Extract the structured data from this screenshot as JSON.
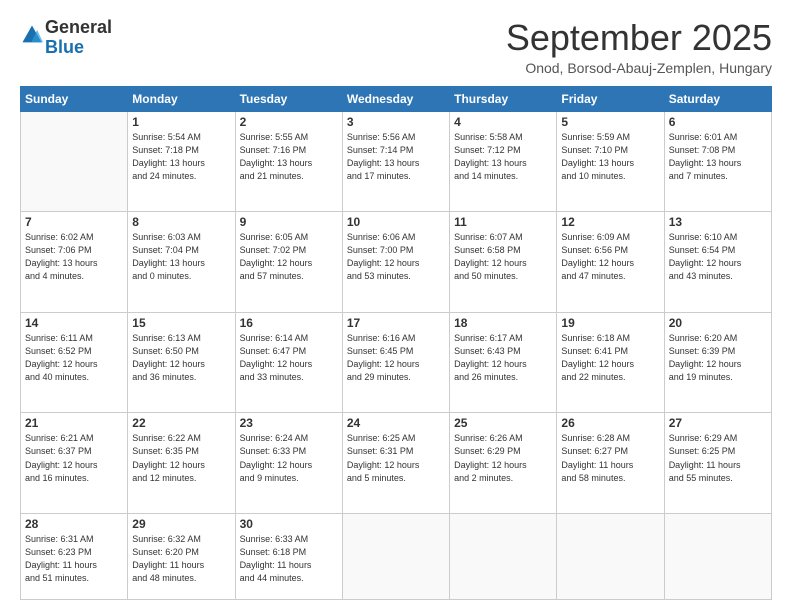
{
  "header": {
    "logo": {
      "line1": "General",
      "line2": "Blue"
    },
    "title": "September 2025",
    "location": "Onod, Borsod-Abauj-Zemplen, Hungary"
  },
  "days_of_week": [
    "Sunday",
    "Monday",
    "Tuesday",
    "Wednesday",
    "Thursday",
    "Friday",
    "Saturday"
  ],
  "weeks": [
    [
      {
        "day": "",
        "info": ""
      },
      {
        "day": "1",
        "info": "Sunrise: 5:54 AM\nSunset: 7:18 PM\nDaylight: 13 hours\nand 24 minutes."
      },
      {
        "day": "2",
        "info": "Sunrise: 5:55 AM\nSunset: 7:16 PM\nDaylight: 13 hours\nand 21 minutes."
      },
      {
        "day": "3",
        "info": "Sunrise: 5:56 AM\nSunset: 7:14 PM\nDaylight: 13 hours\nand 17 minutes."
      },
      {
        "day": "4",
        "info": "Sunrise: 5:58 AM\nSunset: 7:12 PM\nDaylight: 13 hours\nand 14 minutes."
      },
      {
        "day": "5",
        "info": "Sunrise: 5:59 AM\nSunset: 7:10 PM\nDaylight: 13 hours\nand 10 minutes."
      },
      {
        "day": "6",
        "info": "Sunrise: 6:01 AM\nSunset: 7:08 PM\nDaylight: 13 hours\nand 7 minutes."
      }
    ],
    [
      {
        "day": "7",
        "info": "Sunrise: 6:02 AM\nSunset: 7:06 PM\nDaylight: 13 hours\nand 4 minutes."
      },
      {
        "day": "8",
        "info": "Sunrise: 6:03 AM\nSunset: 7:04 PM\nDaylight: 13 hours\nand 0 minutes."
      },
      {
        "day": "9",
        "info": "Sunrise: 6:05 AM\nSunset: 7:02 PM\nDaylight: 12 hours\nand 57 minutes."
      },
      {
        "day": "10",
        "info": "Sunrise: 6:06 AM\nSunset: 7:00 PM\nDaylight: 12 hours\nand 53 minutes."
      },
      {
        "day": "11",
        "info": "Sunrise: 6:07 AM\nSunset: 6:58 PM\nDaylight: 12 hours\nand 50 minutes."
      },
      {
        "day": "12",
        "info": "Sunrise: 6:09 AM\nSunset: 6:56 PM\nDaylight: 12 hours\nand 47 minutes."
      },
      {
        "day": "13",
        "info": "Sunrise: 6:10 AM\nSunset: 6:54 PM\nDaylight: 12 hours\nand 43 minutes."
      }
    ],
    [
      {
        "day": "14",
        "info": "Sunrise: 6:11 AM\nSunset: 6:52 PM\nDaylight: 12 hours\nand 40 minutes."
      },
      {
        "day": "15",
        "info": "Sunrise: 6:13 AM\nSunset: 6:50 PM\nDaylight: 12 hours\nand 36 minutes."
      },
      {
        "day": "16",
        "info": "Sunrise: 6:14 AM\nSunset: 6:47 PM\nDaylight: 12 hours\nand 33 minutes."
      },
      {
        "day": "17",
        "info": "Sunrise: 6:16 AM\nSunset: 6:45 PM\nDaylight: 12 hours\nand 29 minutes."
      },
      {
        "day": "18",
        "info": "Sunrise: 6:17 AM\nSunset: 6:43 PM\nDaylight: 12 hours\nand 26 minutes."
      },
      {
        "day": "19",
        "info": "Sunrise: 6:18 AM\nSunset: 6:41 PM\nDaylight: 12 hours\nand 22 minutes."
      },
      {
        "day": "20",
        "info": "Sunrise: 6:20 AM\nSunset: 6:39 PM\nDaylight: 12 hours\nand 19 minutes."
      }
    ],
    [
      {
        "day": "21",
        "info": "Sunrise: 6:21 AM\nSunset: 6:37 PM\nDaylight: 12 hours\nand 16 minutes."
      },
      {
        "day": "22",
        "info": "Sunrise: 6:22 AM\nSunset: 6:35 PM\nDaylight: 12 hours\nand 12 minutes."
      },
      {
        "day": "23",
        "info": "Sunrise: 6:24 AM\nSunset: 6:33 PM\nDaylight: 12 hours\nand 9 minutes."
      },
      {
        "day": "24",
        "info": "Sunrise: 6:25 AM\nSunset: 6:31 PM\nDaylight: 12 hours\nand 5 minutes."
      },
      {
        "day": "25",
        "info": "Sunrise: 6:26 AM\nSunset: 6:29 PM\nDaylight: 12 hours\nand 2 minutes."
      },
      {
        "day": "26",
        "info": "Sunrise: 6:28 AM\nSunset: 6:27 PM\nDaylight: 11 hours\nand 58 minutes."
      },
      {
        "day": "27",
        "info": "Sunrise: 6:29 AM\nSunset: 6:25 PM\nDaylight: 11 hours\nand 55 minutes."
      }
    ],
    [
      {
        "day": "28",
        "info": "Sunrise: 6:31 AM\nSunset: 6:23 PM\nDaylight: 11 hours\nand 51 minutes."
      },
      {
        "day": "29",
        "info": "Sunrise: 6:32 AM\nSunset: 6:20 PM\nDaylight: 11 hours\nand 48 minutes."
      },
      {
        "day": "30",
        "info": "Sunrise: 6:33 AM\nSunset: 6:18 PM\nDaylight: 11 hours\nand 44 minutes."
      },
      {
        "day": "",
        "info": ""
      },
      {
        "day": "",
        "info": ""
      },
      {
        "day": "",
        "info": ""
      },
      {
        "day": "",
        "info": ""
      }
    ]
  ]
}
